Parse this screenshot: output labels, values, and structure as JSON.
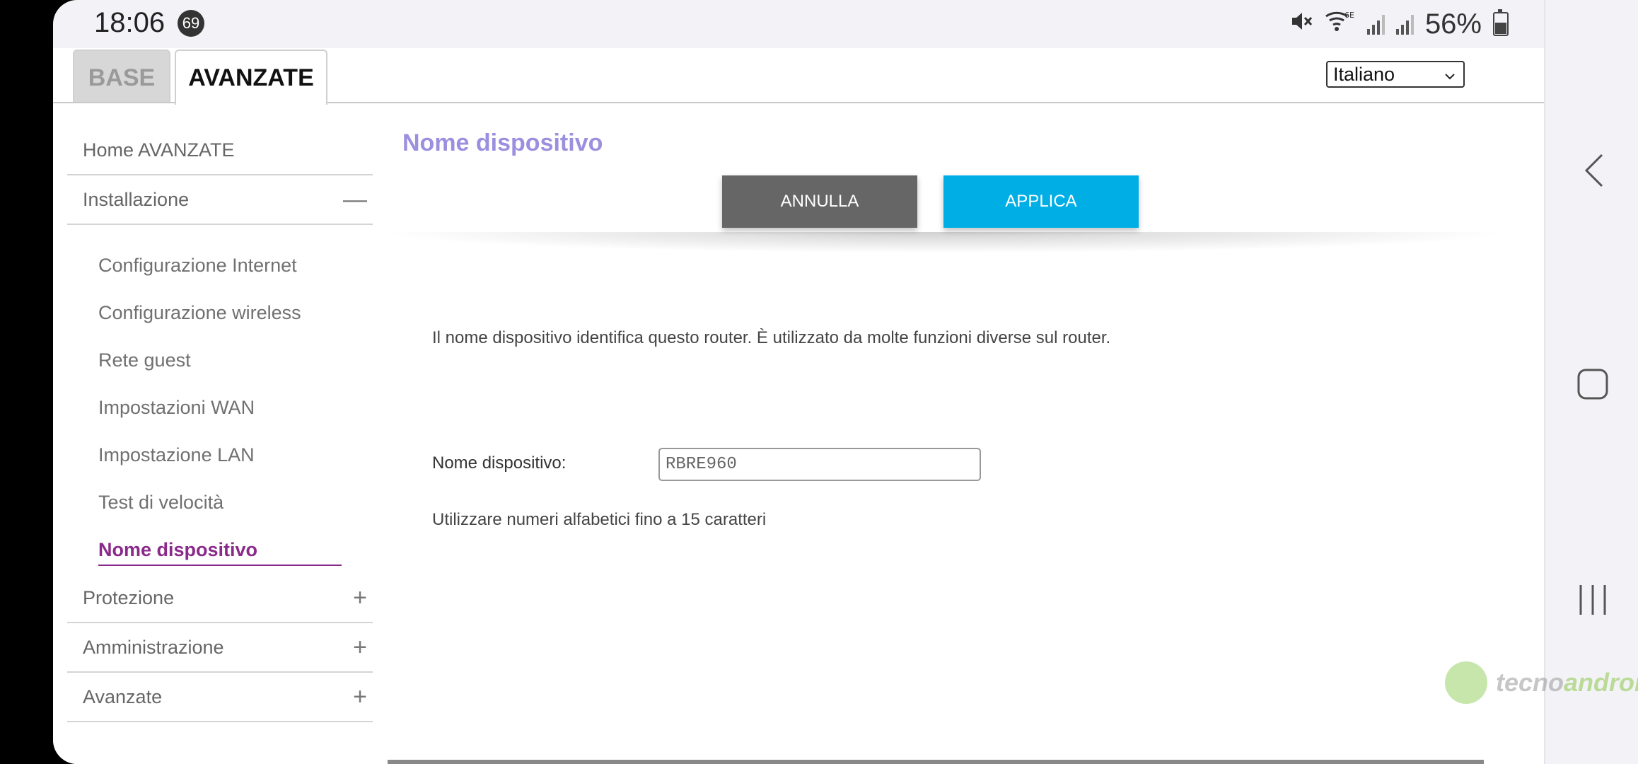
{
  "status_bar": {
    "time": "18:06",
    "notification_count": "69",
    "battery_percent": "56%",
    "icons": [
      "mute-icon",
      "wifi-6e-icon",
      "signal-icon",
      "signal-icon",
      "battery-icon"
    ]
  },
  "tabs": {
    "base": "BASE",
    "advanced": "AVANZATE"
  },
  "language_select": {
    "value": "Italiano"
  },
  "sidebar": {
    "home": "Home AVANZATE",
    "installazione": "Installazione",
    "installazione_toggle": "—",
    "sub_items": [
      "Configurazione Internet",
      "Configurazione wireless",
      "Rete guest",
      "Impostazioni WAN",
      "Impostazione LAN",
      "Test di velocità",
      "Nome dispositivo"
    ],
    "protezione": "Protezione",
    "amministrazione": "Amministrazione",
    "avanzate": "Avanzate",
    "expand_symbol": "+"
  },
  "content": {
    "title": "Nome dispositivo",
    "cancel_label": "ANNULLA",
    "apply_label": "APPLICA",
    "description": "Il nome dispositivo identifica questo router. È utilizzato da molte funzioni diverse sul router.",
    "field_label": "Nome dispositivo:",
    "field_value": "RBRE960",
    "hint": "Utilizzare numeri alfabetici fino a 15 caratteri"
  },
  "watermark": {
    "part1": "tecno",
    "part2": "android"
  },
  "colors": {
    "title": "#9b8fe0",
    "active_item": "#8a2a8a",
    "apply_button": "#00aee6",
    "cancel_button": "#666666"
  }
}
